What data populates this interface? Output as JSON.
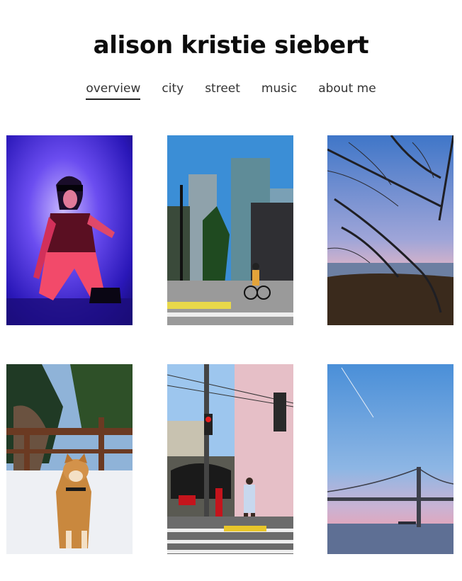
{
  "site": {
    "title": "alison kristie siebert"
  },
  "nav": {
    "items": [
      {
        "label": "overview",
        "active": true
      },
      {
        "label": "city",
        "active": false
      },
      {
        "label": "street",
        "active": false
      },
      {
        "label": "music",
        "active": false
      },
      {
        "label": "about me",
        "active": false
      }
    ]
  },
  "gallery": {
    "photos": [
      {
        "subject": "neon-portrait"
      },
      {
        "subject": "city-cyclist"
      },
      {
        "subject": "tree-dusk"
      },
      {
        "subject": "shiba-dog-snow"
      },
      {
        "subject": "street-crosswalk"
      },
      {
        "subject": "bay-bridge-dusk"
      }
    ]
  }
}
